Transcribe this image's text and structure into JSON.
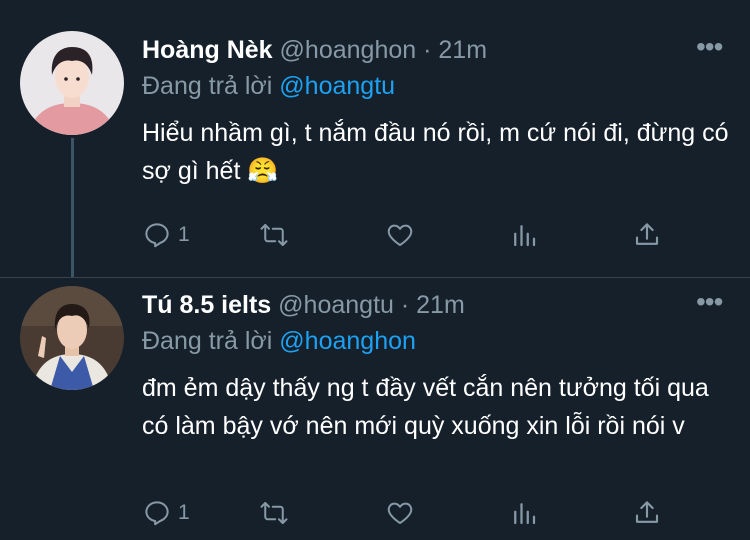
{
  "tweets": [
    {
      "name": "Hoàng Nèk",
      "handle": "@hoanghon",
      "separator": "·",
      "time": "21m",
      "reply_prefix": "Đang trả lời",
      "reply_to": "@hoangtu",
      "text": "Hiểu nhầm gì, t nắm đầu nó rồi, m cứ nói đi, đừng có sợ gì hết 😤",
      "reply_count": "1",
      "more_icon": "more-dots-icon"
    },
    {
      "name": "Tú 8.5 ielts",
      "handle": "@hoangtu",
      "separator": "·",
      "time": "21m",
      "reply_prefix": "Đang trả lời",
      "reply_to": "@hoanghon",
      "text": "đm ẻm dậy thấy ng t đầy vết cắn nên tưởng tối qua có làm bậy vớ nên mới quỳ xuống xin lỗi rồi nói v",
      "reply_count": "1",
      "more_icon": "more-dots-icon"
    }
  ],
  "colors": {
    "background": "#15202b",
    "secondary_text": "#8899a6",
    "accent": "#1da1f2",
    "divider": "#38444d"
  }
}
